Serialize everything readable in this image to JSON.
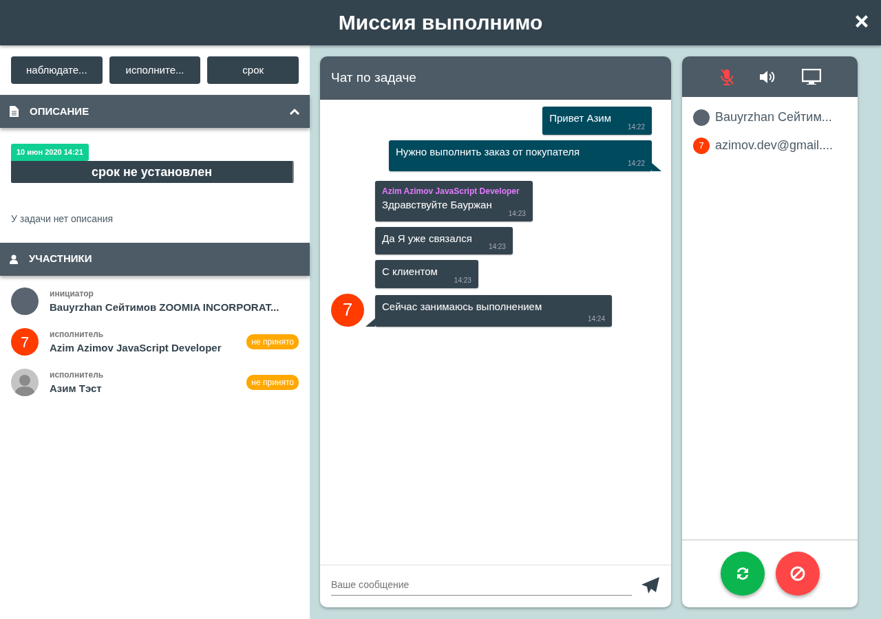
{
  "window": {
    "title": "Миссия выполнимо"
  },
  "filter_buttons": [
    "наблюдате...",
    "исполните...",
    "срок"
  ],
  "description": {
    "title": "ОПИСАНИЕ",
    "expanded": true,
    "date": "10 июн 2020 14:21",
    "deadline": "срок не установлен",
    "text": "У задачи нет описания"
  },
  "participants": {
    "title": "УЧАСТНИКИ",
    "items": [
      {
        "role": "инициатор",
        "name": "Bauyrzhan Сейтимов ZOOMIA INCORPORAT...",
        "avatar": {
          "kind": "photo"
        }
      },
      {
        "role": "исполнитель",
        "name": "Azim Azimov JavaScript Developer",
        "avatar": {
          "kind": "letter",
          "text": "7"
        },
        "badge": "не принято"
      },
      {
        "role": "исполнитель",
        "name": "Азим Тэст",
        "avatar": {
          "kind": "silhouette"
        },
        "badge": "не принято"
      }
    ]
  },
  "chat": {
    "title": "Чат по задаче",
    "messages": [
      {
        "kind": "outgoing",
        "text": "Привет Азим",
        "time": "14:22",
        "tail": false
      },
      {
        "kind": "outgoing",
        "text": "Нужно выполнить заказ от покупателя",
        "time": "14:22",
        "tail": true
      },
      {
        "kind": "incoming",
        "author": "Azim Azimov JavaScript Developer",
        "text": "Здравствуйте Бауржан",
        "time": "14:23",
        "tail": false
      },
      {
        "kind": "incoming",
        "text": "Да Я уже связался",
        "time": "14:23",
        "tail": false
      },
      {
        "kind": "incoming",
        "text": "С клиентом",
        "time": "14:23",
        "tail": false
      },
      {
        "kind": "incoming",
        "text": "Сейчас занимаюсь выполнением",
        "time": "14:24",
        "tail": true,
        "avatar": "7"
      }
    ],
    "input": {
      "placeholder": "Ваше сообщение"
    }
  },
  "call": {
    "muted": true,
    "members": [
      {
        "name": "Bauyrzhan Сейтим...",
        "avatar": {
          "kind": "photo"
        }
      },
      {
        "name": "azimov.dev@gmail....",
        "avatar": {
          "kind": "letter",
          "text": "7"
        }
      }
    ]
  }
}
